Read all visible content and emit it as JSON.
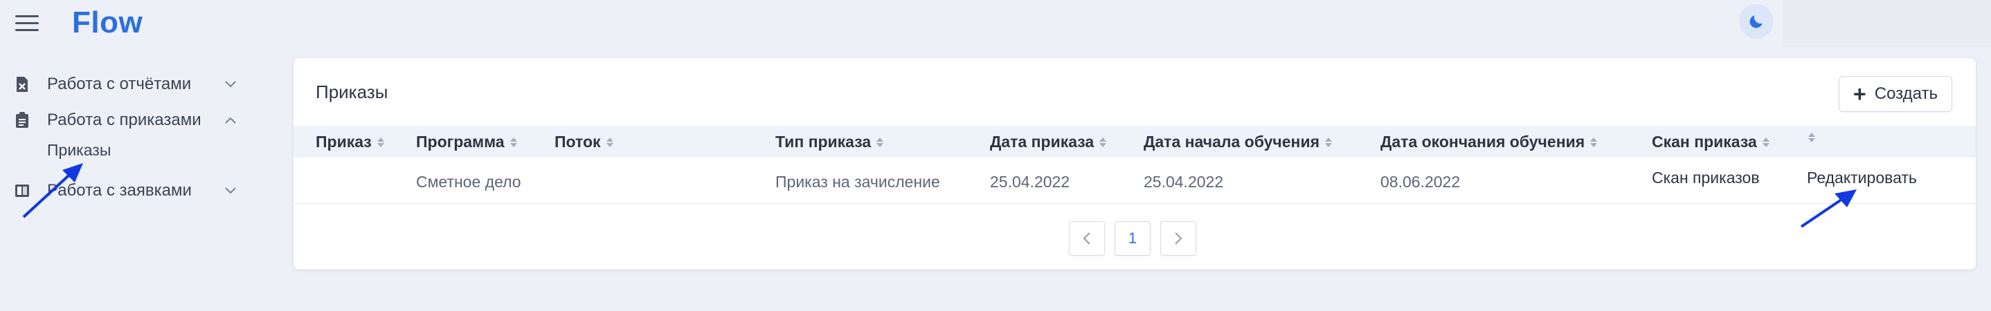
{
  "header": {
    "logo": "Flow",
    "menu_icon": "hamburger-icon",
    "theme_icon": "moon-icon"
  },
  "sidebar": {
    "items": [
      {
        "label": "Работа с отчётами",
        "icon": "report-icon",
        "expanded": false
      },
      {
        "label": "Работа с приказами",
        "icon": "clipboard-icon",
        "expanded": true,
        "children": [
          {
            "label": "Приказы"
          }
        ]
      },
      {
        "label": "Работа с заявками",
        "icon": "book-icon",
        "expanded": false
      }
    ]
  },
  "main": {
    "title": "Приказы",
    "create_label": "Создать",
    "columns": [
      "Приказ",
      "Программа",
      "Поток",
      "Тип приказа",
      "Дата приказа",
      "Дата начала обучения",
      "Дата окончания обучения",
      "Скан приказа",
      ""
    ],
    "rows": [
      {
        "order": "",
        "program": "Сметное дело",
        "stream": "",
        "order_type": "Приказ на зачисление",
        "order_date": "25.04.2022",
        "start_date": "25.04.2022",
        "end_date": "08.06.2022",
        "scan": "Скан приказов",
        "action": "Редактировать"
      }
    ],
    "pagination": {
      "current": "1",
      "pages": [
        "1"
      ]
    }
  },
  "colors": {
    "accent": "#2b6fe0",
    "background": "#edf0f7",
    "annotation_arrow": "#1238e0"
  }
}
